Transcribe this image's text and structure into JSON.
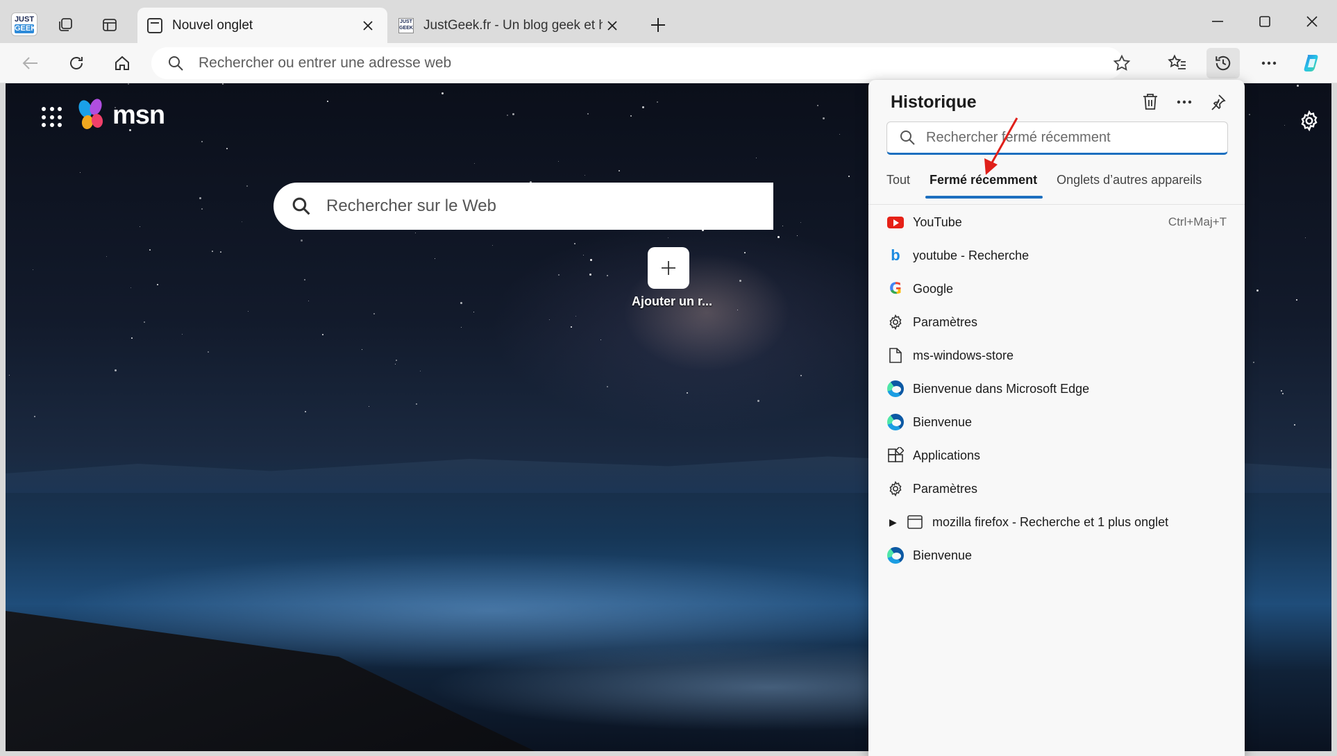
{
  "tabs": [
    {
      "title": "Nouvel onglet",
      "icon": "page-icon",
      "active": true
    },
    {
      "title": "JustGeek.fr - Un blog geek et hig",
      "icon": "justgeek-icon",
      "active": false
    }
  ],
  "app_logo": {
    "top": "JUST",
    "bottom": "GEEK"
  },
  "address_bar": {
    "placeholder": "Rechercher ou entrer une adresse web"
  },
  "msn": {
    "brand": "msn",
    "search_placeholder": "Rechercher sur le Web",
    "add_site_label": "Ajouter un r..."
  },
  "history": {
    "title": "Historique",
    "search_placeholder": "Rechercher fermé récemment",
    "tabs": [
      "Tout",
      "Fermé récemment",
      "Onglets d’autres appareils"
    ],
    "selected_tab": "Fermé récemment",
    "items": [
      {
        "label": "YouTube",
        "icon": "youtube-icon",
        "shortcut": "Ctrl+Maj+T"
      },
      {
        "label": "youtube - Recherche",
        "icon": "bing-icon",
        "shortcut": ""
      },
      {
        "label": "Google",
        "icon": "google-icon",
        "shortcut": ""
      },
      {
        "label": "Paramètres",
        "icon": "gear-icon",
        "shortcut": ""
      },
      {
        "label": "ms-windows-store",
        "icon": "document-icon",
        "shortcut": ""
      },
      {
        "label": "Bienvenue dans Microsoft Edge",
        "icon": "edge-icon",
        "shortcut": ""
      },
      {
        "label": "Bienvenue",
        "icon": "edge-icon",
        "shortcut": ""
      },
      {
        "label": "Applications",
        "icon": "apps-icon",
        "shortcut": ""
      },
      {
        "label": "Paramètres",
        "icon": "gear-icon",
        "shortcut": ""
      },
      {
        "label": "mozilla firefox - Recherche et 1 plus onglet",
        "icon": "window-group-icon",
        "shortcut": "",
        "expandable": true
      },
      {
        "label": "Bienvenue",
        "icon": "edge-icon",
        "shortcut": ""
      }
    ]
  },
  "colors": {
    "accent": "#1d6fbf",
    "annotation_arrow": "#e0201a"
  }
}
